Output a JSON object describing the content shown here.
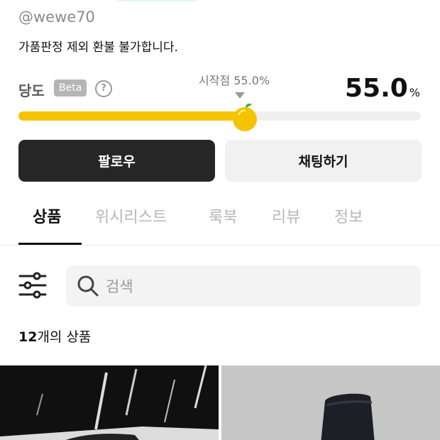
{
  "profile": {
    "handle": "@wewe70",
    "bio": "가품판정 제외 환불 불가합니다."
  },
  "sweetness": {
    "label": "당도",
    "badge": "Beta",
    "help": "?",
    "start_label": "시작점 55.0%",
    "value": "55.0",
    "unit": "%",
    "level": 0.55,
    "accent_color": "#f5c400"
  },
  "actions": {
    "follow_label": "팔로우",
    "chat_label": "채팅하기"
  },
  "tabs": [
    {
      "label": "상품",
      "active": true
    },
    {
      "label": "위시리스트",
      "active": false
    },
    {
      "label": "룩북",
      "active": false
    },
    {
      "label": "리뷰",
      "active": false
    },
    {
      "label": "정보",
      "active": false
    }
  ],
  "search": {
    "placeholder": "검색",
    "value": ""
  },
  "product_count": {
    "count": "12",
    "suffix": "개의 상품"
  },
  "icons": {
    "filter": "filter-sliders-icon",
    "search": "search-icon",
    "help": "question-circle-icon",
    "fruit": "fruit-knob-icon",
    "marker": "triangle-marker-icon"
  }
}
